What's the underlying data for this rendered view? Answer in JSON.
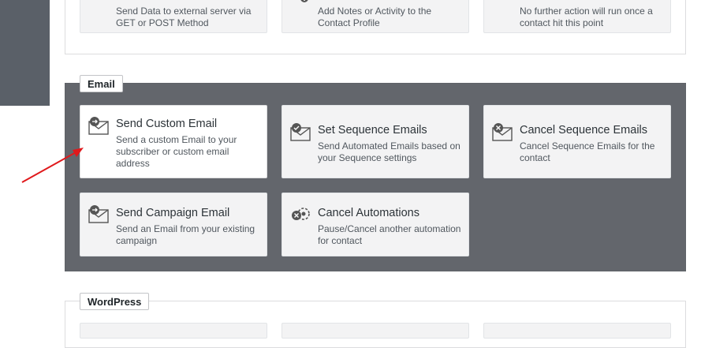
{
  "top_section": {
    "cards": [
      {
        "desc": "Send Data to external server via GET or POST Method"
      },
      {
        "desc": "Add Notes or Activity to the Contact Profile"
      },
      {
        "desc": "No further action will run once a contact hit this point"
      }
    ]
  },
  "email_section": {
    "label": "Email",
    "cards": [
      {
        "title": "Send Custom Email",
        "desc": "Send a custom Email to your subscriber or custom email address"
      },
      {
        "title": "Set Sequence Emails",
        "desc": "Send Automated Emails based on your Sequence settings"
      },
      {
        "title": "Cancel Sequence Emails",
        "desc": "Cancel Sequence Emails for the contact"
      },
      {
        "title": "Send Campaign Email",
        "desc": "Send an Email from your existing campaign"
      },
      {
        "title": "Cancel Automations",
        "desc": "Pause/Cancel another automation for contact"
      }
    ]
  },
  "wordpress_section": {
    "label": "WordPress"
  },
  "colors": {
    "email_bg": "#63666c",
    "card_bg": "#f3f3f4",
    "arrow": "#e0191c"
  }
}
